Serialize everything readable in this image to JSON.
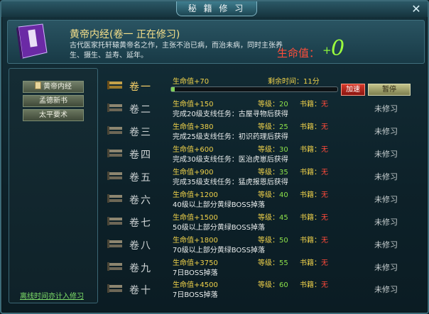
{
  "window": {
    "title": "秘 籍 修 习"
  },
  "header": {
    "book_title": "黄帝内经(卷一  正在修习)",
    "description": "古代医家托轩辕黄帝名之作，主张不治已病，而治未病，同时主张养生、摄生、益寿、延年。",
    "life_label": "生命值：",
    "life_plus": "+",
    "life_value": "0"
  },
  "sidebar": {
    "items": [
      {
        "label": "黄帝内经",
        "active": true
      },
      {
        "label": "孟德新书",
        "active": false
      },
      {
        "label": "太平要术",
        "active": false
      }
    ],
    "offline_note": "离线时间亦计入修习"
  },
  "current": {
    "volume": "卷一",
    "hp": "生命值+70",
    "remain": "剩余时间：11分",
    "progress": 0.02,
    "speed_button": "加速",
    "pause_button": "暂停"
  },
  "volumes": [
    {
      "volume": "卷二",
      "hp": "生命值+150",
      "lv_label": "等级：",
      "lv": "20",
      "bk_label": "书籍：",
      "bk": "无",
      "cond": "完成20级支线任务：古屋寻物后获得",
      "status": "未修习"
    },
    {
      "volume": "卷三",
      "hp": "生命值+380",
      "lv_label": "等级：",
      "lv": "25",
      "bk_label": "书籍：",
      "bk": "无",
      "cond": "完成25级支线任务：初识药理后获得",
      "status": "未修习"
    },
    {
      "volume": "卷四",
      "hp": "生命值+600",
      "lv_label": "等级：",
      "lv": "30",
      "bk_label": "书籍：",
      "bk": "无",
      "cond": "完成30级支线任务：医治虎崽后获得",
      "status": "未修习"
    },
    {
      "volume": "卷五",
      "hp": "生命值+900",
      "lv_label": "等级：",
      "lv": "35",
      "bk_label": "书籍：",
      "bk": "无",
      "cond": "完成35级支线任务：猛虎报恩后获得",
      "status": "未修习"
    },
    {
      "volume": "卷六",
      "hp": "生命值+1200",
      "lv_label": "等级：",
      "lv": "40",
      "bk_label": "书籍：",
      "bk": "无",
      "cond": "40级以上部分黄绿BOSS掉落",
      "status": "未修习"
    },
    {
      "volume": "卷七",
      "hp": "生命值+1500",
      "lv_label": "等级：",
      "lv": "45",
      "bk_label": "书籍：",
      "bk": "无",
      "cond": "50级以上部分黄绿BOSS掉落",
      "status": "未修习"
    },
    {
      "volume": "卷八",
      "hp": "生命值+1800",
      "lv_label": "等级：",
      "lv": "50",
      "bk_label": "书籍：",
      "bk": "无",
      "cond": "70级以上部分黄绿BOSS掉落",
      "status": "未修习"
    },
    {
      "volume": "卷九",
      "hp": "生命值+3750",
      "lv_label": "等级：",
      "lv": "55",
      "bk_label": "书籍：",
      "bk": "无",
      "cond": "7日BOSS掉落",
      "status": "未修习"
    },
    {
      "volume": "卷十",
      "hp": "生命值+4500",
      "lv_label": "等级：",
      "lv": "60",
      "bk_label": "书籍：",
      "bk": "无",
      "cond": "7日BOSS掉落",
      "status": "未修习"
    }
  ]
}
